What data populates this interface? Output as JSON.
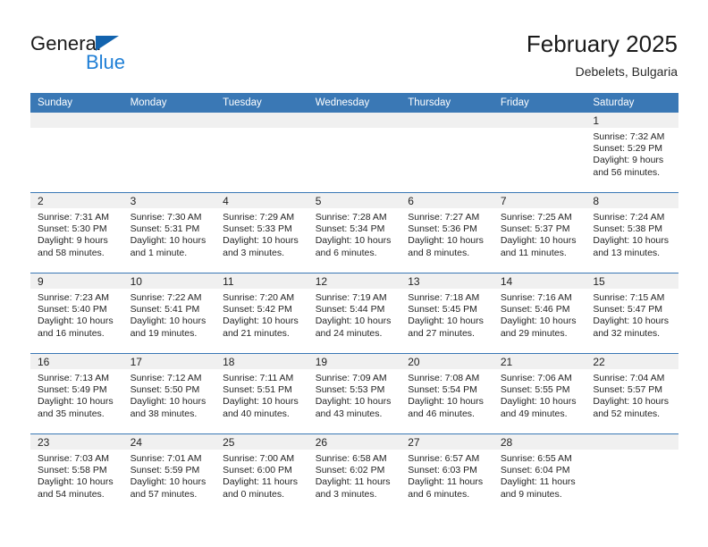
{
  "brand": {
    "name_part1": "General",
    "name_part2": "Blue",
    "triangle_color": "#1263ae",
    "blue_text_color": "#1f7fd6"
  },
  "header": {
    "month_title": "February 2025",
    "location": "Debelets, Bulgaria",
    "header_row_color": "#3a78b5",
    "daynum_band_color": "#f0f0f0"
  },
  "weekday_headers": [
    "Sunday",
    "Monday",
    "Tuesday",
    "Wednesday",
    "Thursday",
    "Friday",
    "Saturday"
  ],
  "weeks": [
    [
      {
        "day": "",
        "empty": true
      },
      {
        "day": "",
        "empty": true
      },
      {
        "day": "",
        "empty": true
      },
      {
        "day": "",
        "empty": true
      },
      {
        "day": "",
        "empty": true
      },
      {
        "day": "",
        "empty": true
      },
      {
        "day": "1",
        "sunrise": "Sunrise: 7:32 AM",
        "sunset": "Sunset: 5:29 PM",
        "daylight_line1": "Daylight: 9 hours",
        "daylight_line2": "and 56 minutes."
      }
    ],
    [
      {
        "day": "2",
        "sunrise": "Sunrise: 7:31 AM",
        "sunset": "Sunset: 5:30 PM",
        "daylight_line1": "Daylight: 9 hours",
        "daylight_line2": "and 58 minutes."
      },
      {
        "day": "3",
        "sunrise": "Sunrise: 7:30 AM",
        "sunset": "Sunset: 5:31 PM",
        "daylight_line1": "Daylight: 10 hours",
        "daylight_line2": "and 1 minute."
      },
      {
        "day": "4",
        "sunrise": "Sunrise: 7:29 AM",
        "sunset": "Sunset: 5:33 PM",
        "daylight_line1": "Daylight: 10 hours",
        "daylight_line2": "and 3 minutes."
      },
      {
        "day": "5",
        "sunrise": "Sunrise: 7:28 AM",
        "sunset": "Sunset: 5:34 PM",
        "daylight_line1": "Daylight: 10 hours",
        "daylight_line2": "and 6 minutes."
      },
      {
        "day": "6",
        "sunrise": "Sunrise: 7:27 AM",
        "sunset": "Sunset: 5:36 PM",
        "daylight_line1": "Daylight: 10 hours",
        "daylight_line2": "and 8 minutes."
      },
      {
        "day": "7",
        "sunrise": "Sunrise: 7:25 AM",
        "sunset": "Sunset: 5:37 PM",
        "daylight_line1": "Daylight: 10 hours",
        "daylight_line2": "and 11 minutes."
      },
      {
        "day": "8",
        "sunrise": "Sunrise: 7:24 AM",
        "sunset": "Sunset: 5:38 PM",
        "daylight_line1": "Daylight: 10 hours",
        "daylight_line2": "and 13 minutes."
      }
    ],
    [
      {
        "day": "9",
        "sunrise": "Sunrise: 7:23 AM",
        "sunset": "Sunset: 5:40 PM",
        "daylight_line1": "Daylight: 10 hours",
        "daylight_line2": "and 16 minutes."
      },
      {
        "day": "10",
        "sunrise": "Sunrise: 7:22 AM",
        "sunset": "Sunset: 5:41 PM",
        "daylight_line1": "Daylight: 10 hours",
        "daylight_line2": "and 19 minutes."
      },
      {
        "day": "11",
        "sunrise": "Sunrise: 7:20 AM",
        "sunset": "Sunset: 5:42 PM",
        "daylight_line1": "Daylight: 10 hours",
        "daylight_line2": "and 21 minutes."
      },
      {
        "day": "12",
        "sunrise": "Sunrise: 7:19 AM",
        "sunset": "Sunset: 5:44 PM",
        "daylight_line1": "Daylight: 10 hours",
        "daylight_line2": "and 24 minutes."
      },
      {
        "day": "13",
        "sunrise": "Sunrise: 7:18 AM",
        "sunset": "Sunset: 5:45 PM",
        "daylight_line1": "Daylight: 10 hours",
        "daylight_line2": "and 27 minutes."
      },
      {
        "day": "14",
        "sunrise": "Sunrise: 7:16 AM",
        "sunset": "Sunset: 5:46 PM",
        "daylight_line1": "Daylight: 10 hours",
        "daylight_line2": "and 29 minutes."
      },
      {
        "day": "15",
        "sunrise": "Sunrise: 7:15 AM",
        "sunset": "Sunset: 5:47 PM",
        "daylight_line1": "Daylight: 10 hours",
        "daylight_line2": "and 32 minutes."
      }
    ],
    [
      {
        "day": "16",
        "sunrise": "Sunrise: 7:13 AM",
        "sunset": "Sunset: 5:49 PM",
        "daylight_line1": "Daylight: 10 hours",
        "daylight_line2": "and 35 minutes."
      },
      {
        "day": "17",
        "sunrise": "Sunrise: 7:12 AM",
        "sunset": "Sunset: 5:50 PM",
        "daylight_line1": "Daylight: 10 hours",
        "daylight_line2": "and 38 minutes."
      },
      {
        "day": "18",
        "sunrise": "Sunrise: 7:11 AM",
        "sunset": "Sunset: 5:51 PM",
        "daylight_line1": "Daylight: 10 hours",
        "daylight_line2": "and 40 minutes."
      },
      {
        "day": "19",
        "sunrise": "Sunrise: 7:09 AM",
        "sunset": "Sunset: 5:53 PM",
        "daylight_line1": "Daylight: 10 hours",
        "daylight_line2": "and 43 minutes."
      },
      {
        "day": "20",
        "sunrise": "Sunrise: 7:08 AM",
        "sunset": "Sunset: 5:54 PM",
        "daylight_line1": "Daylight: 10 hours",
        "daylight_line2": "and 46 minutes."
      },
      {
        "day": "21",
        "sunrise": "Sunrise: 7:06 AM",
        "sunset": "Sunset: 5:55 PM",
        "daylight_line1": "Daylight: 10 hours",
        "daylight_line2": "and 49 minutes."
      },
      {
        "day": "22",
        "sunrise": "Sunrise: 7:04 AM",
        "sunset": "Sunset: 5:57 PM",
        "daylight_line1": "Daylight: 10 hours",
        "daylight_line2": "and 52 minutes."
      }
    ],
    [
      {
        "day": "23",
        "sunrise": "Sunrise: 7:03 AM",
        "sunset": "Sunset: 5:58 PM",
        "daylight_line1": "Daylight: 10 hours",
        "daylight_line2": "and 54 minutes."
      },
      {
        "day": "24",
        "sunrise": "Sunrise: 7:01 AM",
        "sunset": "Sunset: 5:59 PM",
        "daylight_line1": "Daylight: 10 hours",
        "daylight_line2": "and 57 minutes."
      },
      {
        "day": "25",
        "sunrise": "Sunrise: 7:00 AM",
        "sunset": "Sunset: 6:00 PM",
        "daylight_line1": "Daylight: 11 hours",
        "daylight_line2": "and 0 minutes."
      },
      {
        "day": "26",
        "sunrise": "Sunrise: 6:58 AM",
        "sunset": "Sunset: 6:02 PM",
        "daylight_line1": "Daylight: 11 hours",
        "daylight_line2": "and 3 minutes."
      },
      {
        "day": "27",
        "sunrise": "Sunrise: 6:57 AM",
        "sunset": "Sunset: 6:03 PM",
        "daylight_line1": "Daylight: 11 hours",
        "daylight_line2": "and 6 minutes."
      },
      {
        "day": "28",
        "sunrise": "Sunrise: 6:55 AM",
        "sunset": "Sunset: 6:04 PM",
        "daylight_line1": "Daylight: 11 hours",
        "daylight_line2": "and 9 minutes."
      },
      {
        "day": "",
        "empty": true
      }
    ]
  ]
}
